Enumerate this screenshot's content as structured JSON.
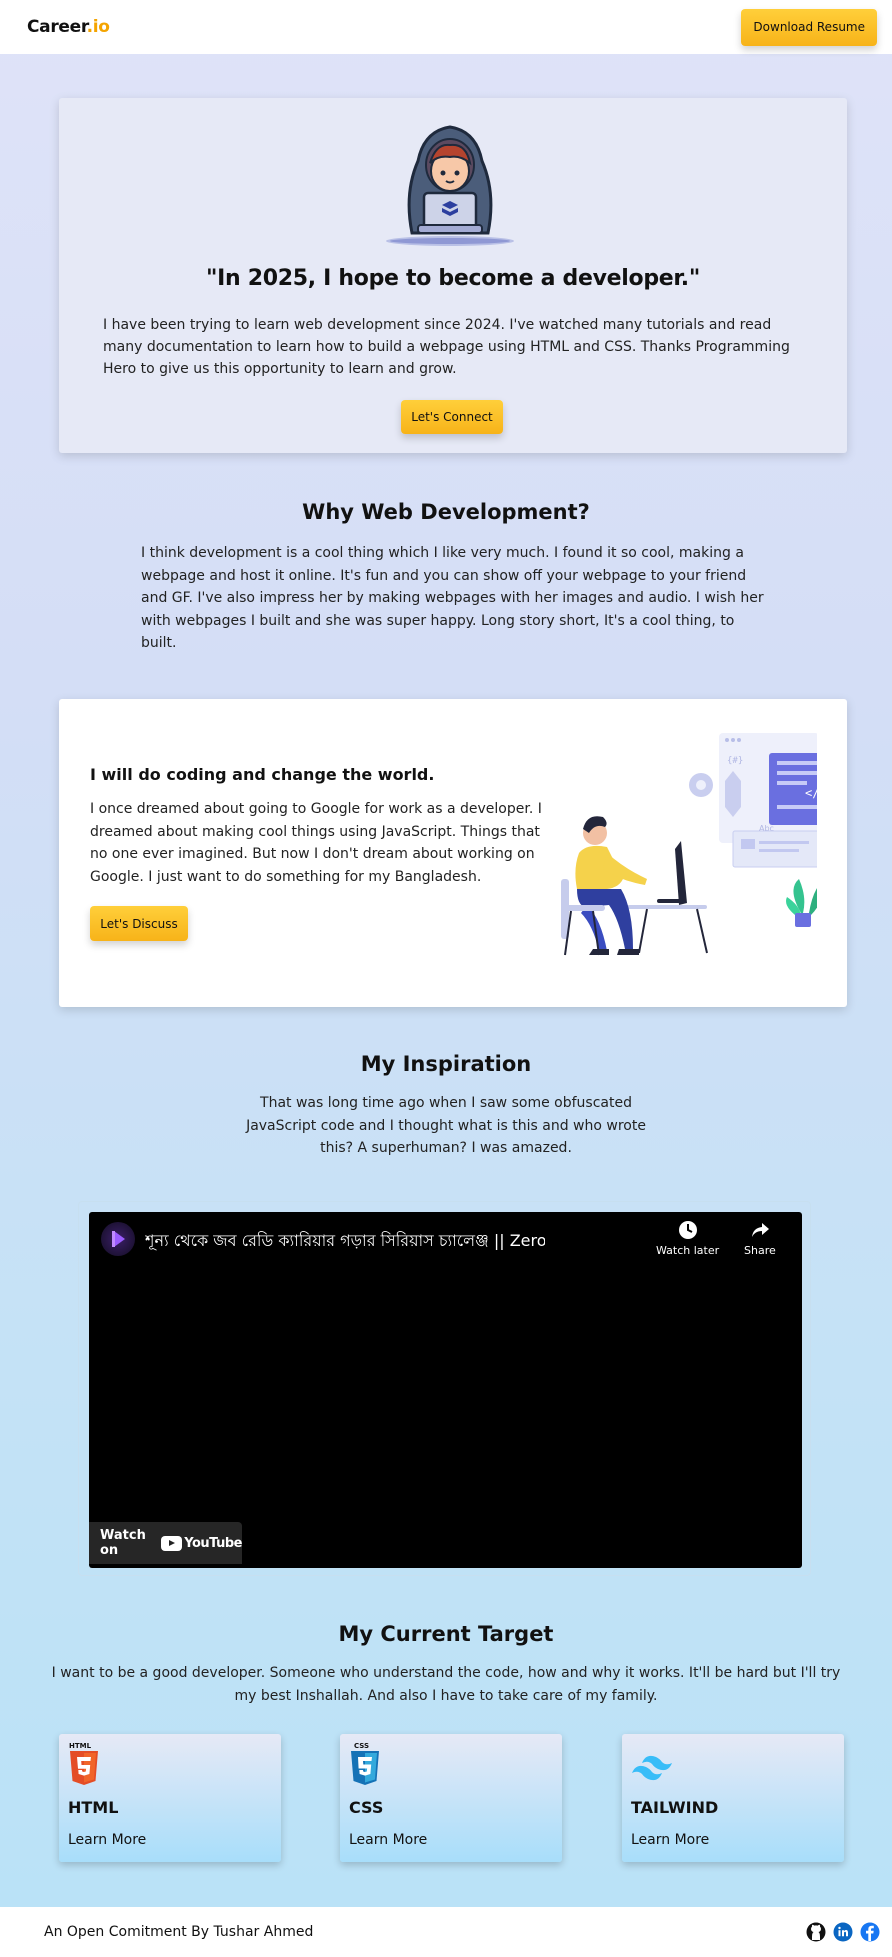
{
  "nav": {
    "logo_main": "Career",
    "logo_tld": ".io",
    "resume_label": "Download Resume"
  },
  "hero": {
    "quote": "\"In 2025, I hope to become a developer.\"",
    "text": "I have been trying to learn web development since 2024. I've watched many tutorials and read many documentation to learn how to build a webpage using HTML and CSS. Thanks Programming Hero to give us this opportunity to learn and grow.",
    "button": "Let's Connect"
  },
  "why": {
    "title": "Why Web Development?",
    "text": "I think development is a cool thing which I like very much. I found it so cool, making a webpage and host it online. It's fun and you can show off your webpage to your friend and GF. I've also impress her by making webpages with her images and audio. I wish her with webpages I built and she was super happy. Long story short, It's a cool thing, to built."
  },
  "coding": {
    "title": "I will do coding and change the world.",
    "text": "I once dreamed about going to Google for work as a developer. I dreamed about making cool things using JavaScript. Things that no one ever imagined. But now I don't dream about working on Google. I just want to do something for my Bangladesh.",
    "button": "Let's Discuss"
  },
  "inspiration": {
    "title": "My Inspiration",
    "text": "That was long time ago when I saw some obfuscated JavaScript code and I thought what is this and who wrote this? A superhuman? I was amazed."
  },
  "video": {
    "title": "শূন্য থেকে জব রেডি ক্যারিয়ার গড়ার সিরিয়াস চ্যালেঞ্জ || Zero to Career C...",
    "watch_later": "Watch later",
    "share": "Share",
    "watch_on": "Watch on",
    "youtube": "YouTube"
  },
  "target": {
    "title": "My Current Target",
    "text": "I want to be a good developer. Someone who understand the code, how and why it works. It'll be hard but I'll try my best Inshallah. And also I have to take care of my family.",
    "cards": [
      {
        "name": "HTML",
        "link": "Learn More",
        "badge": "HTML",
        "color": "#e44d26"
      },
      {
        "name": "CSS",
        "link": "Learn More",
        "badge": "CSS",
        "color": "#1572b6"
      },
      {
        "name": "TAILWIND",
        "link": "Learn More",
        "color": "#38bdf8"
      }
    ]
  },
  "footer": {
    "text": "An Open Comitment By Tushar Ahmed",
    "icons": [
      "github-icon",
      "linkedin-icon",
      "facebook-icon"
    ]
  },
  "colors": {
    "accent_yellow": "#f7b319",
    "brand_tld": "#f4a400"
  }
}
